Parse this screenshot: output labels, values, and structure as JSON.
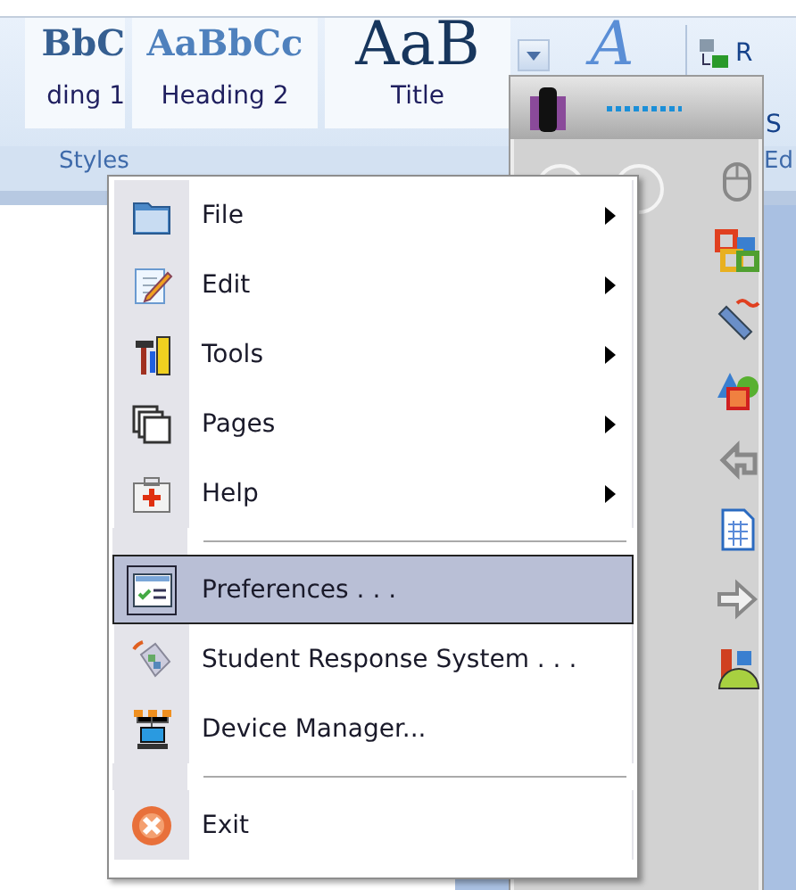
{
  "ribbon": {
    "gallery": [
      {
        "sample": "BbC",
        "label": "ding 1"
      },
      {
        "sample": "AaBbCc",
        "label": "Heading 2"
      },
      {
        "sample": "AaB",
        "label": "Title"
      }
    ],
    "change_styles": "A",
    "group_label": "Styles",
    "editing": {
      "replace": "R",
      "select": "S",
      "group_label": "Ed"
    }
  },
  "menu": {
    "items": [
      {
        "kind": "item",
        "label": "File",
        "has_submenu": true,
        "selected": false
      },
      {
        "kind": "item",
        "label": "Edit",
        "has_submenu": true,
        "selected": false
      },
      {
        "kind": "item",
        "label": "Tools",
        "has_submenu": true,
        "selected": false
      },
      {
        "kind": "item",
        "label": "Pages",
        "has_submenu": true,
        "selected": false
      },
      {
        "kind": "item",
        "label": "Help",
        "has_submenu": true,
        "selected": false
      },
      {
        "kind": "separator"
      },
      {
        "kind": "item",
        "label": "Preferences . . .",
        "has_submenu": false,
        "selected": true
      },
      {
        "kind": "item",
        "label": "Student Response System . . .",
        "has_submenu": false,
        "selected": false
      },
      {
        "kind": "item",
        "label": "Device Manager...",
        "has_submenu": false,
        "selected": false
      },
      {
        "kind": "separator"
      },
      {
        "kind": "item",
        "label": "Exit",
        "has_submenu": false,
        "selected": false
      }
    ]
  }
}
